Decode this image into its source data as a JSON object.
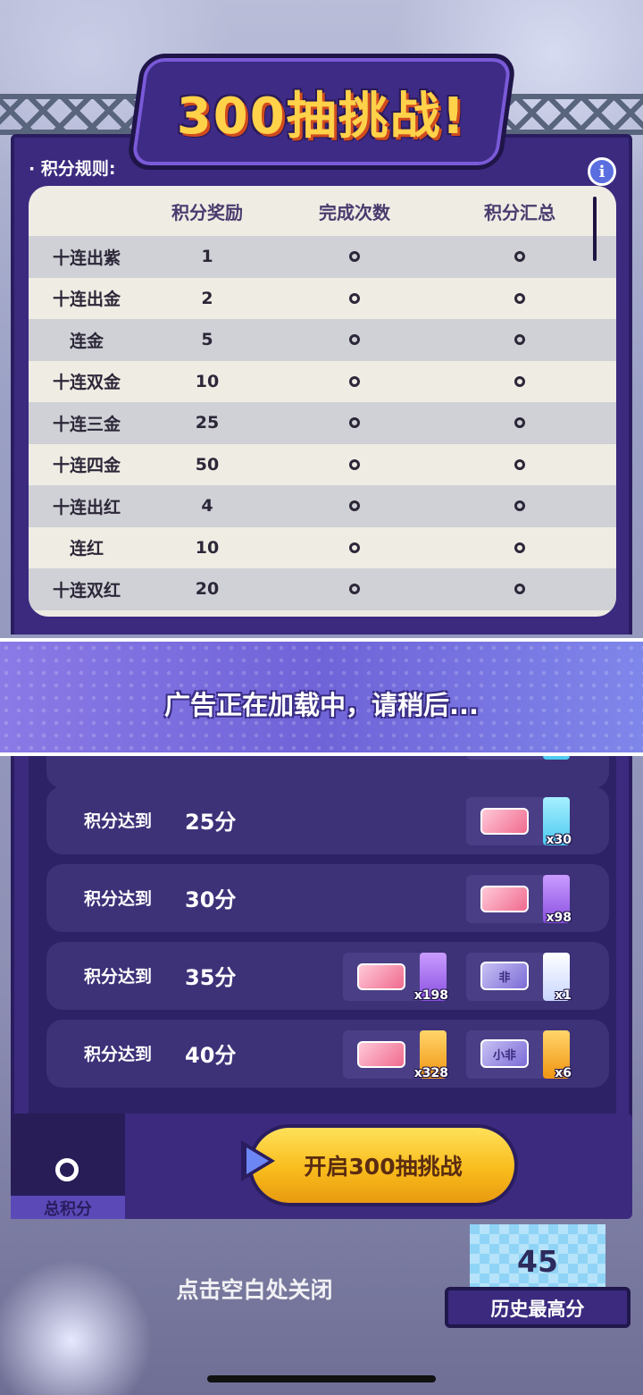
{
  "title": "300抽挑战!",
  "rules": {
    "label": "· 积分规则:",
    "headers": [
      "",
      "积分奖励",
      "完成次数",
      "积分汇总"
    ],
    "rows": [
      {
        "name": "十连出紫",
        "reward": "1",
        "count": "0",
        "total": "0"
      },
      {
        "name": "十连出金",
        "reward": "2",
        "count": "0",
        "total": "0"
      },
      {
        "name": "连金",
        "reward": "5",
        "count": "0",
        "total": "0"
      },
      {
        "name": "十连双金",
        "reward": "10",
        "count": "0",
        "total": "0"
      },
      {
        "name": "十连三金",
        "reward": "25",
        "count": "0",
        "total": "0"
      },
      {
        "name": "十连四金",
        "reward": "50",
        "count": "0",
        "total": "0"
      },
      {
        "name": "十连出红",
        "reward": "4",
        "count": "0",
        "total": "0"
      },
      {
        "name": "连红",
        "reward": "10",
        "count": "0",
        "total": "0"
      },
      {
        "name": "十连双红",
        "reward": "20",
        "count": "0",
        "total": "0"
      }
    ]
  },
  "ad_banner": "广告正在加载中，请稍后...",
  "milestones": [
    {
      "label": "积分达到",
      "score": "25分",
      "rewards": [
        {
          "icon": "pink-ticket-icon",
          "tag": "cyan",
          "qty": "x30"
        }
      ]
    },
    {
      "label": "积分达到",
      "score": "30分",
      "rewards": [
        {
          "icon": "pink-ticket-icon",
          "tag": "purple",
          "qty": "x98"
        }
      ]
    },
    {
      "label": "积分达到",
      "score": "35分",
      "rewards": [
        {
          "icon": "pink-ticket-icon",
          "tag": "purple",
          "qty": "x198"
        },
        {
          "icon": "pass-ticket-icon",
          "text": "非",
          "tag": "white",
          "qty": "x1"
        }
      ]
    },
    {
      "label": "积分达到",
      "score": "40分",
      "rewards": [
        {
          "icon": "pink-ticket-icon",
          "tag": "orange",
          "qty": "x328"
        },
        {
          "icon": "pass-ticket-icon",
          "text": "小非",
          "tag": "orange",
          "qty": "x6"
        }
      ]
    }
  ],
  "total": {
    "value": "0",
    "label": "总积分"
  },
  "start_button": "开启300抽挑战",
  "close_hint": "点击空白处关闭",
  "best": {
    "value": "45",
    "label": "历史最高分"
  }
}
